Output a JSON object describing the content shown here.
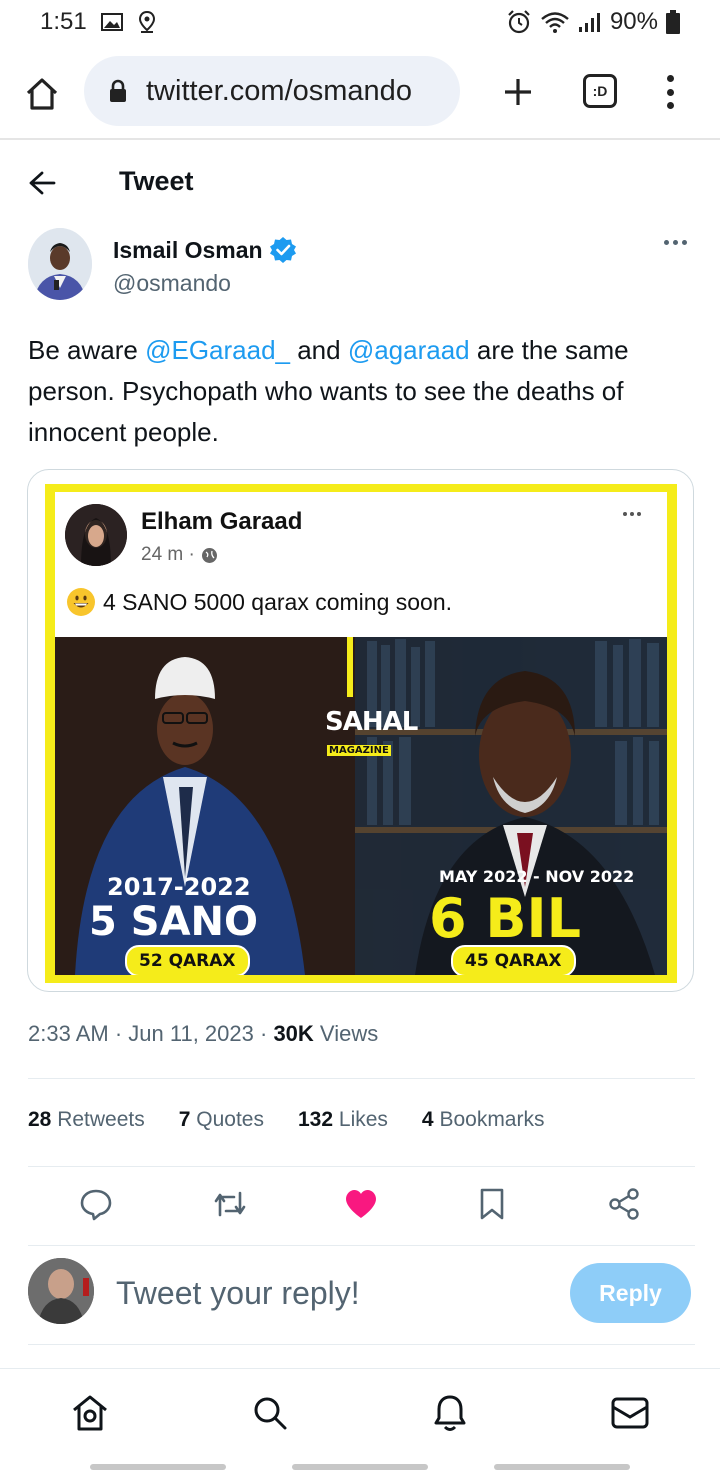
{
  "status_bar": {
    "time": "1:51",
    "battery": "90%"
  },
  "browser": {
    "url": "twitter.com/osmando",
    "tabs_label": ":D"
  },
  "header": {
    "title": "Tweet"
  },
  "tweet": {
    "author_name": "Ismail Osman",
    "author_handle": "@osmando",
    "text_parts": {
      "t1": "Be aware ",
      "m1": "@EGaraad_",
      "t2": " and ",
      "m2": "@agaraad",
      "t3": " are the same person. Psychopath who wants to see the deaths of innocent people."
    },
    "time": "2:33 AM",
    "date": "Jun 11, 2023",
    "views_count": "30K",
    "views_label": "Views"
  },
  "embedded_post": {
    "name": "Elham Garaad",
    "time": "24 m ·",
    "text": "4 SANO 5000 qarax coming soon.",
    "image_labels": {
      "brand": "SAHAL",
      "brand_sub": "MAGAZINE",
      "left_years": "2017-2022",
      "left_big": "5 SANO",
      "left_pill": "52 QARAX",
      "right_dates": "MAY 2022 - NOV 2022",
      "right_big": "6 BIL",
      "right_pill": "45 QARAX"
    }
  },
  "stats": {
    "retweets_count": "28",
    "retweets_label": "Retweets",
    "quotes_count": "7",
    "quotes_label": "Quotes",
    "likes_count": "132",
    "likes_label": "Likes",
    "bookmarks_count": "4",
    "bookmarks_label": "Bookmarks"
  },
  "reply": {
    "placeholder": "Tweet your reply!",
    "button_label": "Reply"
  },
  "colors": {
    "accent": "#1d9bf0",
    "like": "#f91880",
    "reply_button": "#8ecdf8",
    "frame_yellow": "#f5ec1a"
  }
}
